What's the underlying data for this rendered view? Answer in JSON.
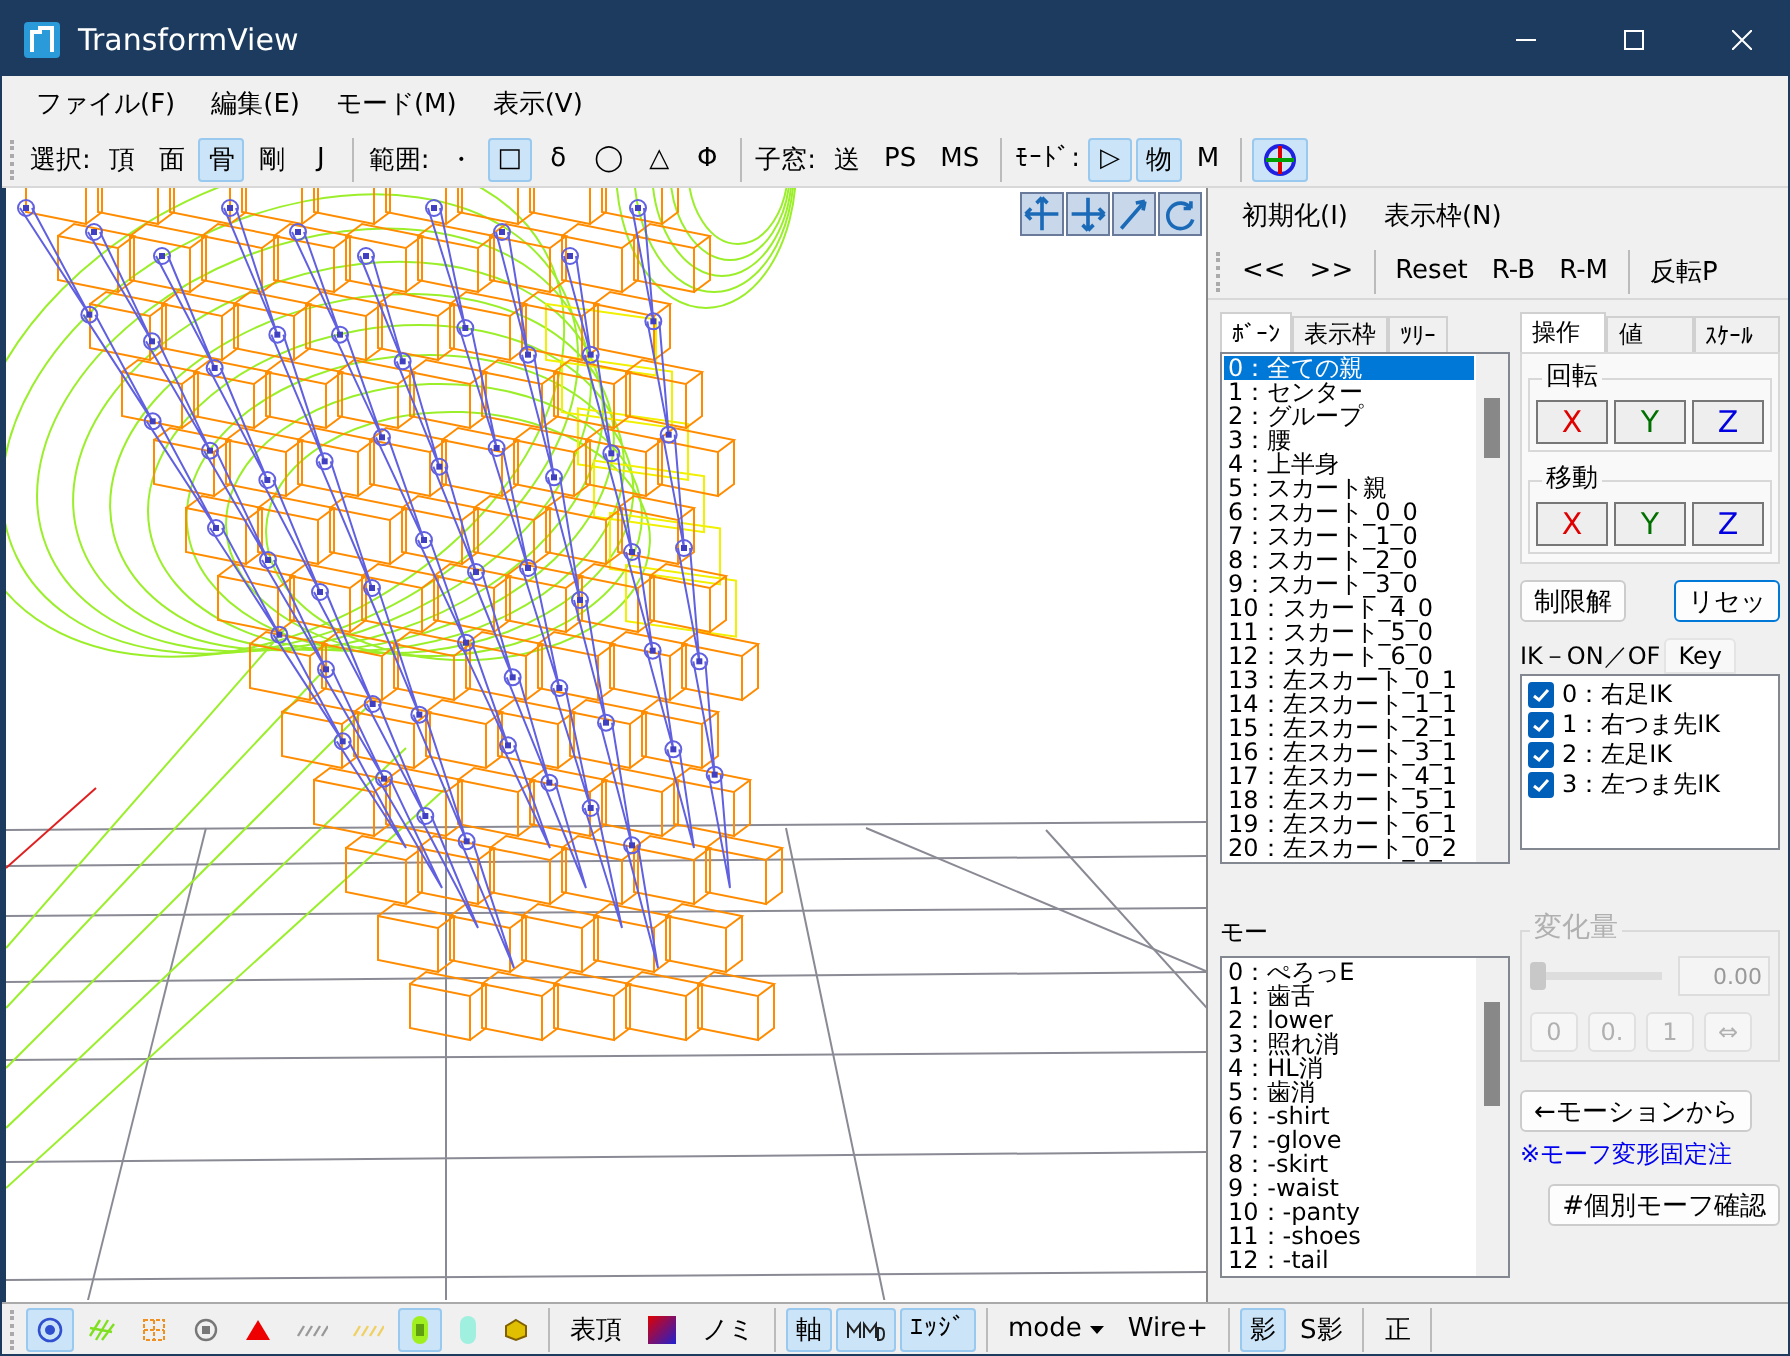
{
  "window": {
    "title": "TransformView"
  },
  "menu": [
    "ファイル(F)",
    "編集(E)",
    "モード(M)",
    "表示(V)"
  ],
  "toolbar": [
    {
      "kind": "text",
      "label": "選択:",
      "buttons": [
        {
          "label": "頂",
          "selected": false
        },
        {
          "label": "面",
          "selected": false
        },
        {
          "label": "骨",
          "selected": true
        },
        {
          "label": "剛",
          "selected": false
        },
        {
          "label": "J",
          "selected": false
        }
      ]
    },
    {
      "kind": "text",
      "label": "範囲:",
      "buttons": [
        {
          "label": "・",
          "selected": false
        },
        {
          "label": "□",
          "selected": true
        },
        {
          "label": "δ",
          "selected": false
        },
        {
          "label": "◯",
          "selected": false
        },
        {
          "label": "△",
          "selected": false
        },
        {
          "label": "Φ",
          "selected": false
        }
      ]
    },
    {
      "kind": "text",
      "label": "子窓:",
      "buttons": [
        {
          "label": "送",
          "selected": false
        },
        {
          "label": "PS",
          "selected": false
        },
        {
          "label": "MS",
          "selected": false
        }
      ]
    },
    {
      "kind": "text",
      "label": "ﾓｰﾄﾞ:",
      "buttons": [
        {
          "label": "▷",
          "selected": true
        },
        {
          "label": "物",
          "selected": true
        },
        {
          "label": "M",
          "selected": false
        }
      ]
    },
    {
      "kind": "icon",
      "selected": true
    }
  ],
  "panel": {
    "menu": [
      "初期化(I)",
      "表示枠(N)"
    ],
    "toolbar": [
      [
        "<<",
        ">>"
      ],
      [
        "Reset",
        "R-B",
        "R-M"
      ],
      [
        "反転P"
      ]
    ],
    "bone_tabs": [
      {
        "label": "ﾎﾞｰﾝ",
        "selected": true
      },
      {
        "label": "表示枠",
        "selected": false
      },
      {
        "label": "ﾂﾘｰ",
        "selected": false
      }
    ],
    "bones": [
      {
        "label": "0：全ての親",
        "selected": true
      },
      {
        "label": "1：センター",
        "selected": false
      },
      {
        "label": "2：グループ",
        "selected": false
      },
      {
        "label": "3：腰",
        "selected": false
      },
      {
        "label": "4：上半身",
        "selected": false
      },
      {
        "label": "5：スカート親",
        "selected": false
      },
      {
        "label": "6：スカート_0_0",
        "selected": false
      },
      {
        "label": "7：スカート_1_0",
        "selected": false
      },
      {
        "label": "8：スカート_2_0",
        "selected": false
      },
      {
        "label": "9：スカート_3_0",
        "selected": false
      },
      {
        "label": "10：スカート_4_0",
        "selected": false
      },
      {
        "label": "11：スカート_5_0",
        "selected": false
      },
      {
        "label": "12：スカート_6_0",
        "selected": false
      },
      {
        "label": "13：左スカート_0_1",
        "selected": false
      },
      {
        "label": "14：左スカート_1_1",
        "selected": false
      },
      {
        "label": "15：左スカート_2_1",
        "selected": false
      },
      {
        "label": "16：左スカート_3_1",
        "selected": false
      },
      {
        "label": "17：左スカート_4_1",
        "selected": false
      },
      {
        "label": "18：左スカート_5_1",
        "selected": false
      },
      {
        "label": "19：左スカート_6_1",
        "selected": false
      },
      {
        "label": "20：左スカート_0_2",
        "selected": false
      }
    ],
    "morph_label": "モー",
    "morphs": [
      {
        "label": "0：ぺろっE",
        "selected": false
      },
      {
        "label": "1：歯舌",
        "selected": false
      },
      {
        "label": "2：lower",
        "selected": false
      },
      {
        "label": "3：照れ消",
        "selected": false
      },
      {
        "label": "4：HL消",
        "selected": false
      },
      {
        "label": "5：歯消",
        "selected": false
      },
      {
        "label": "6：-shirt",
        "selected": false
      },
      {
        "label": "7：-glove",
        "selected": false
      },
      {
        "label": "8：-skirt",
        "selected": false
      },
      {
        "label": "9：-waist",
        "selected": false
      },
      {
        "label": "10：-panty",
        "selected": false
      },
      {
        "label": "11：-shoes",
        "selected": false
      },
      {
        "label": "12：-tail",
        "selected": false
      }
    ],
    "op_tabs": [
      {
        "label": "操作",
        "selected": true
      },
      {
        "label": "値",
        "selected": false
      },
      {
        "label": "ｽｹｰﾙ",
        "selected": false
      }
    ],
    "groups": [
      {
        "title": "回転",
        "axes": [
          {
            "label": "X",
            "color": "#e00000"
          },
          {
            "label": "Y",
            "color": "#007000"
          },
          {
            "label": "Z",
            "color": "#0000e0"
          }
        ]
      },
      {
        "title": "移動",
        "axes": [
          {
            "label": "X",
            "color": "#e00000"
          },
          {
            "label": "Y",
            "color": "#007000"
          },
          {
            "label": "Z",
            "color": "#0000e0"
          }
        ]
      }
    ],
    "actions": [
      {
        "label": "制限解",
        "focused": false
      },
      {
        "label": "リセッ",
        "focused": true
      }
    ],
    "ik": {
      "label": "IK－ON／OF",
      "key_tab": "Key",
      "items": [
        {
          "label": "0：右足IK",
          "checked": true
        },
        {
          "label": "1：右つま先IK",
          "checked": true
        },
        {
          "label": "2：左足IK",
          "checked": true
        },
        {
          "label": "3：左つま先IK",
          "checked": true
        }
      ]
    },
    "change": {
      "title": "変化量",
      "disabled": true,
      "level": 0,
      "value": "0.00",
      "buttons": [
        "0",
        "0.",
        "1",
        "⇔"
      ]
    },
    "from_motion": "←モーションから",
    "note": "※モーフ変形固定注",
    "check_button": "#個別モーフ確認"
  },
  "bottom_bar": [
    {
      "kind": "icon",
      "selected": true
    },
    {
      "kind": "icon",
      "selected": false
    },
    {
      "kind": "icon",
      "selected": false
    },
    {
      "kind": "icon",
      "selected": false
    },
    {
      "kind": "icon",
      "selected": false
    },
    {
      "kind": "icon",
      "selected": false
    },
    {
      "kind": "icon",
      "selected": false
    },
    {
      "kind": "icon",
      "selected": true
    },
    {
      "kind": "icon",
      "selected": false
    },
    {
      "kind": "icon",
      "selected": false
    },
    {
      "kind": "sep"
    },
    {
      "kind": "text",
      "label": "表頂",
      "selected": false
    },
    {
      "kind": "icon",
      "selected": false
    },
    {
      "kind": "text",
      "label": "ノミ",
      "selected": false
    },
    {
      "kind": "sep"
    },
    {
      "kind": "text",
      "label": "軸",
      "selected": true
    },
    {
      "kind": "icon",
      "selected": true
    },
    {
      "kind": "text",
      "label": "ｴｯｼﾞ",
      "selected": true
    },
    {
      "kind": "sep"
    },
    {
      "kind": "dropdown",
      "label": "mode"
    },
    {
      "kind": "text",
      "label": "Wire+",
      "selected": false
    },
    {
      "kind": "sep"
    },
    {
      "kind": "text",
      "label": "影",
      "selected": true
    },
    {
      "kind": "text",
      "label": "S影",
      "selected": false
    },
    {
      "kind": "sep"
    },
    {
      "kind": "text",
      "label": "正",
      "selected": false
    },
    {
      "kind": "sep"
    }
  ]
}
